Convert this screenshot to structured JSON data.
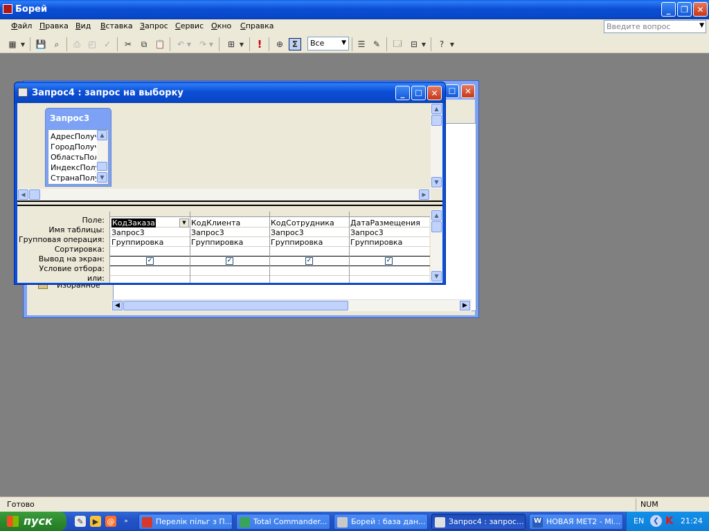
{
  "app": {
    "title": "Борей"
  },
  "menu": {
    "items": [
      {
        "label": "Файл",
        "u": "Ф",
        "rest": "айл"
      },
      {
        "label": "Правка",
        "u": "П",
        "rest": "равка"
      },
      {
        "label": "Вид",
        "u": "В",
        "rest": "ид"
      },
      {
        "label": "Вставка",
        "u": "В",
        "rest": "ставка"
      },
      {
        "label": "Запрос",
        "u": "З",
        "rest": "апрос"
      },
      {
        "label": "Сервис",
        "u": "С",
        "rest": "ервис"
      },
      {
        "label": "Окно",
        "u": "О",
        "rest": "кно"
      },
      {
        "label": "Справка",
        "u": "С",
        "rest": "правка"
      }
    ],
    "help_placeholder": "Введите вопрос"
  },
  "toolbar": {
    "top_values": "Все",
    "sigma": "Σ",
    "run": "!"
  },
  "db_window": {
    "favorites_label": "Избранное"
  },
  "query_window": {
    "title": "Запрос4 : запрос на выборку",
    "field_list": {
      "title": "Запрос3",
      "items": [
        "АдресПолуча",
        "ГородПолуча",
        "ОбластьПолу",
        "ИндексПолуч",
        "СтранаПолуч"
      ]
    },
    "row_labels": [
      "Поле:",
      "Имя таблицы:",
      "Групповая операция:",
      "Сортировка:",
      "Вывод на экран:",
      "Условие отбора:",
      "или:"
    ],
    "columns": [
      {
        "field": "КодЗаказа",
        "table": "Запрос3",
        "group": "Группировка",
        "show": true
      },
      {
        "field": "КодКлиента",
        "table": "Запрос3",
        "group": "Группировка",
        "show": true
      },
      {
        "field": "КодСотрудника",
        "table": "Запрос3",
        "group": "Группировка",
        "show": true
      },
      {
        "field": "ДатаРазмещения",
        "table": "Запрос3",
        "group": "Группировка",
        "show": true
      }
    ]
  },
  "status": {
    "text": "Готово",
    "num": "NUM"
  },
  "taskbar": {
    "start": "пуск",
    "tasks": [
      {
        "label": "Перелік пільг з П...",
        "active": false,
        "icon_color": "#d7382b"
      },
      {
        "label": "Total Commander...",
        "active": false,
        "icon_color": "#3aa35b"
      },
      {
        "label": "Борей : база дан...",
        "active": false,
        "icon_color": "#c9c9c9"
      },
      {
        "label": "Запрос4 : запрос...",
        "active": true,
        "icon_color": "#e0e0e0"
      },
      {
        "label": "НОВАЯ МЕТ2 - Mi...",
        "active": false,
        "icon_color": "#2b5cb8"
      }
    ],
    "lang": "EN",
    "clock": "21:24"
  },
  "colors": {
    "xp_blue": "#0b4fd7",
    "workspace": "#808080",
    "face": "#ece9d8"
  }
}
